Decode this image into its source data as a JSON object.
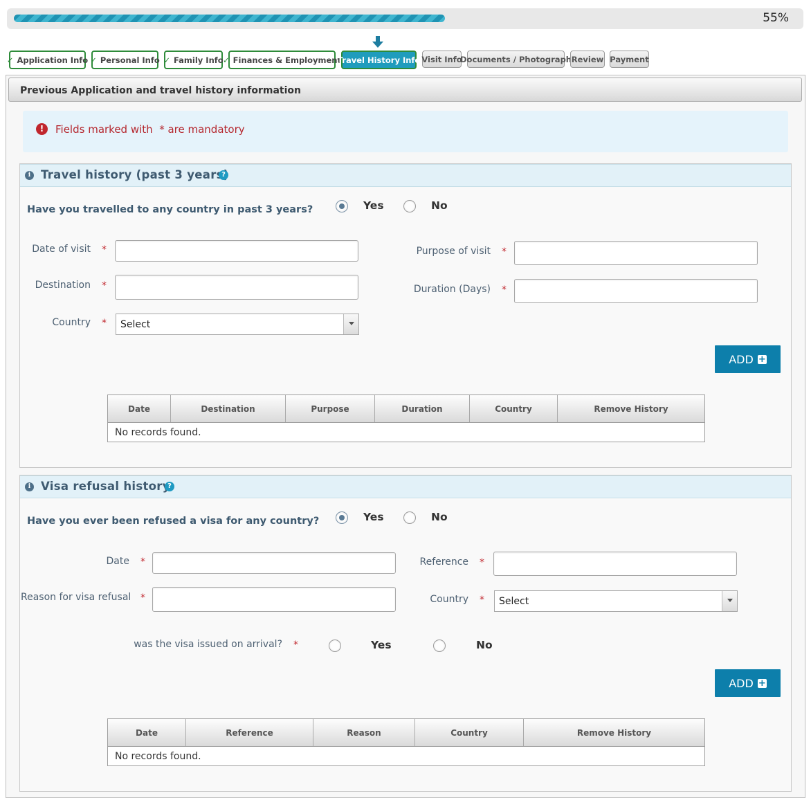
{
  "progress": {
    "percent": 55,
    "label": "55%"
  },
  "steps": {
    "application_info": "Application Info",
    "personal_info": "Personal Info",
    "family_info": "Family Info",
    "finances_employment": "Finances & Employment",
    "travel_history_info": "Travel History Info",
    "visit_info": "Visit Info",
    "documents_photograph": "Documents / Photograph",
    "review": "Review",
    "payment": "Payment",
    "check_glyph": "✓"
  },
  "panel": {
    "title": "Previous Application and travel history information"
  },
  "notice": {
    "icon": "!",
    "text": "Fields marked with  * are mandatory"
  },
  "travel": {
    "title": "Travel history (past 3 years)",
    "question": "Have you travelled to any country in past 3 years?",
    "yes": "Yes",
    "no": "No",
    "selected": "Yes",
    "date_label": "Date of visit",
    "destination_label": "Destination",
    "country_label": "Country",
    "purpose_label": "Purpose of visit",
    "duration_label": "Duration (Days)",
    "country_value": "Select",
    "add": "ADD",
    "columns": [
      "Date",
      "Destination",
      "Purpose",
      "Duration",
      "Country",
      "Remove History"
    ],
    "empty": "No records found."
  },
  "refusal": {
    "title": "Visa refusal history",
    "question": "Have you ever been refused a visa for any country?",
    "yes": "Yes",
    "no": "No",
    "selected": "Yes",
    "date_label": "Date",
    "reason_label": "Reason for visa refusal",
    "reference_label": "Reference",
    "country_label": "Country",
    "country_value": "Select",
    "arrival_question": "was the visa issued on arrival?",
    "arrival_yes": "Yes",
    "arrival_no": "No",
    "add": "ADD",
    "columns": [
      "Date",
      "Reference",
      "Reason",
      "Country",
      "Remove History"
    ],
    "empty": "No records found."
  },
  "common": {
    "required_mark": "*",
    "info_glyph": "i",
    "help_glyph": "?",
    "plus_glyph": "+"
  },
  "icons": {
    "arrow": "down-arrow-icon",
    "info": "info-icon",
    "help": "help-icon",
    "alert": "exclamation-icon",
    "add": "plus-icon"
  },
  "colors": {
    "accent": "#1f9cbd",
    "done_border": "#2e8b3a",
    "required": "#c0262d",
    "button": "#0d7fab"
  }
}
